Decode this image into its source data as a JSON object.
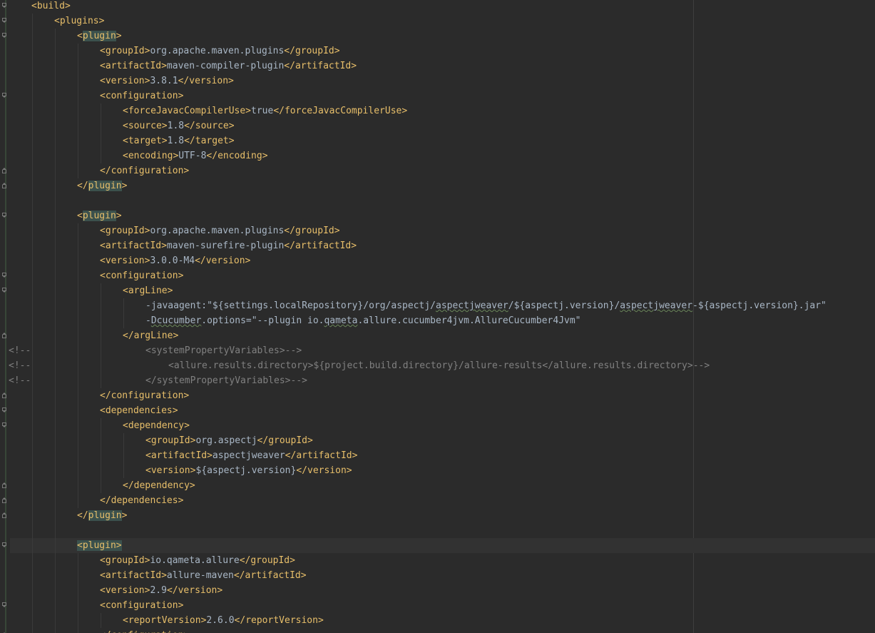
{
  "editor": {
    "lines": [
      {
        "fold": "open",
        "indent": 1,
        "tokens": [
          {
            "t": "<build>",
            "c": "tag"
          }
        ]
      },
      {
        "fold": "open",
        "indent": 2,
        "tokens": [
          {
            "t": "<plugins>",
            "c": "tag"
          }
        ]
      },
      {
        "fold": "open",
        "indent": 3,
        "tokens": [
          {
            "t": "<",
            "c": "tag"
          },
          {
            "t": "plugin",
            "c": "tag-hl"
          },
          {
            "t": ">",
            "c": "tag"
          }
        ]
      },
      {
        "fold": "",
        "indent": 4,
        "tokens": [
          {
            "t": "<groupId>",
            "c": "tag"
          },
          {
            "t": "org.apache.maven.plugins",
            "c": "text"
          },
          {
            "t": "</groupId>",
            "c": "tag"
          }
        ]
      },
      {
        "fold": "",
        "indent": 4,
        "tokens": [
          {
            "t": "<artifactId>",
            "c": "tag"
          },
          {
            "t": "maven-compiler-plugin",
            "c": "text"
          },
          {
            "t": "</artifactId>",
            "c": "tag"
          }
        ]
      },
      {
        "fold": "",
        "indent": 4,
        "tokens": [
          {
            "t": "<version>",
            "c": "tag"
          },
          {
            "t": "3.8.1",
            "c": "text"
          },
          {
            "t": "</version>",
            "c": "tag"
          }
        ]
      },
      {
        "fold": "open",
        "indent": 4,
        "tokens": [
          {
            "t": "<configuration>",
            "c": "tag"
          }
        ]
      },
      {
        "fold": "",
        "indent": 5,
        "tokens": [
          {
            "t": "<forceJavacCompilerUse>",
            "c": "tag"
          },
          {
            "t": "true",
            "c": "text"
          },
          {
            "t": "</forceJavacCompilerUse>",
            "c": "tag"
          }
        ]
      },
      {
        "fold": "",
        "indent": 5,
        "tokens": [
          {
            "t": "<source>",
            "c": "tag"
          },
          {
            "t": "1.8",
            "c": "text"
          },
          {
            "t": "</source>",
            "c": "tag"
          }
        ]
      },
      {
        "fold": "",
        "indent": 5,
        "tokens": [
          {
            "t": "<target>",
            "c": "tag"
          },
          {
            "t": "1.8",
            "c": "text"
          },
          {
            "t": "</target>",
            "c": "tag"
          }
        ]
      },
      {
        "fold": "",
        "indent": 5,
        "tokens": [
          {
            "t": "<encoding>",
            "c": "tag"
          },
          {
            "t": "UTF-8",
            "c": "text"
          },
          {
            "t": "</encoding>",
            "c": "tag"
          }
        ]
      },
      {
        "fold": "close",
        "indent": 4,
        "tokens": [
          {
            "t": "</configuration>",
            "c": "tag"
          }
        ]
      },
      {
        "fold": "close",
        "indent": 3,
        "tokens": [
          {
            "t": "</",
            "c": "tag"
          },
          {
            "t": "plugin",
            "c": "tag-hl"
          },
          {
            "t": ">",
            "c": "tag"
          }
        ]
      },
      {
        "fold": "",
        "indent": 0,
        "tokens": []
      },
      {
        "fold": "open",
        "indent": 3,
        "tokens": [
          {
            "t": "<",
            "c": "tag"
          },
          {
            "t": "plugin",
            "c": "tag-hl"
          },
          {
            "t": ">",
            "c": "tag"
          }
        ]
      },
      {
        "fold": "",
        "indent": 4,
        "tokens": [
          {
            "t": "<groupId>",
            "c": "tag"
          },
          {
            "t": "org.apache.maven.plugins",
            "c": "text"
          },
          {
            "t": "</groupId>",
            "c": "tag"
          }
        ]
      },
      {
        "fold": "",
        "indent": 4,
        "tokens": [
          {
            "t": "<artifactId>",
            "c": "tag"
          },
          {
            "t": "maven-surefire-plugin",
            "c": "text"
          },
          {
            "t": "</artifactId>",
            "c": "tag"
          }
        ]
      },
      {
        "fold": "",
        "indent": 4,
        "tokens": [
          {
            "t": "<version>",
            "c": "tag"
          },
          {
            "t": "3.0.0-M4",
            "c": "text"
          },
          {
            "t": "</version>",
            "c": "tag"
          }
        ]
      },
      {
        "fold": "open",
        "indent": 4,
        "tokens": [
          {
            "t": "<configuration>",
            "c": "tag"
          }
        ]
      },
      {
        "fold": "open",
        "indent": 5,
        "tokens": [
          {
            "t": "<argLine>",
            "c": "tag"
          }
        ]
      },
      {
        "fold": "",
        "indent": 6,
        "tokens": [
          {
            "t": "-javaagent:\"${settings.localRepository}/org/aspectj/",
            "c": "text"
          },
          {
            "t": "aspectjweaver",
            "c": "text warn"
          },
          {
            "t": "/${aspectj.version}/",
            "c": "text"
          },
          {
            "t": "aspectjweaver",
            "c": "text warn"
          },
          {
            "t": "-${aspectj.version}.jar\"",
            "c": "text"
          }
        ]
      },
      {
        "fold": "",
        "indent": 6,
        "tokens": [
          {
            "t": "-",
            "c": "text"
          },
          {
            "t": "Dcucumber",
            "c": "text warn"
          },
          {
            "t": ".options=\"--plugin io.",
            "c": "text"
          },
          {
            "t": "qameta",
            "c": "text warn"
          },
          {
            "t": ".allure.cucumber4jvm.AllureCucumber4Jvm\"",
            "c": "text"
          }
        ]
      },
      {
        "fold": "close",
        "indent": 5,
        "tokens": [
          {
            "t": "</argLine>",
            "c": "tag"
          }
        ]
      },
      {
        "fold": "",
        "indent": 0,
        "prefix": "<!--",
        "tokens": [
          {
            "t": "<systemPropertyVariables>-->",
            "c": "comment"
          }
        ],
        "commentIndent": 6
      },
      {
        "fold": "",
        "indent": 0,
        "prefix": "<!--",
        "tokens": [
          {
            "t": "<allure.results.directory>${project.build.directory}/allure-results</allure.results.directory>-->",
            "c": "comment"
          }
        ],
        "commentIndent": 7
      },
      {
        "fold": "",
        "indent": 0,
        "prefix": "<!--",
        "tokens": [
          {
            "t": "</systemPropertyVariables>-->",
            "c": "comment"
          }
        ],
        "commentIndent": 6
      },
      {
        "fold": "close",
        "indent": 4,
        "tokens": [
          {
            "t": "</configuration>",
            "c": "tag"
          }
        ]
      },
      {
        "fold": "open",
        "indent": 4,
        "tokens": [
          {
            "t": "<dependencies>",
            "c": "tag"
          }
        ]
      },
      {
        "fold": "open",
        "indent": 5,
        "tokens": [
          {
            "t": "<dependency>",
            "c": "tag"
          }
        ]
      },
      {
        "fold": "",
        "indent": 6,
        "tokens": [
          {
            "t": "<groupId>",
            "c": "tag"
          },
          {
            "t": "org.aspectj",
            "c": "text"
          },
          {
            "t": "</groupId>",
            "c": "tag"
          }
        ]
      },
      {
        "fold": "",
        "indent": 6,
        "tokens": [
          {
            "t": "<artifactId>",
            "c": "tag"
          },
          {
            "t": "aspectjweaver",
            "c": "text"
          },
          {
            "t": "</artifactId>",
            "c": "tag"
          }
        ]
      },
      {
        "fold": "",
        "indent": 6,
        "tokens": [
          {
            "t": "<version>",
            "c": "tag"
          },
          {
            "t": "${aspectj.version}",
            "c": "text"
          },
          {
            "t": "</version>",
            "c": "tag"
          }
        ]
      },
      {
        "fold": "close",
        "indent": 5,
        "tokens": [
          {
            "t": "</dependency>",
            "c": "tag"
          }
        ]
      },
      {
        "fold": "close",
        "indent": 4,
        "tokens": [
          {
            "t": "</dependencies>",
            "c": "tag"
          }
        ]
      },
      {
        "fold": "close",
        "indent": 3,
        "tokens": [
          {
            "t": "</",
            "c": "tag"
          },
          {
            "t": "plugin",
            "c": "tag-hl"
          },
          {
            "t": ">",
            "c": "tag"
          }
        ]
      },
      {
        "fold": "",
        "indent": 0,
        "tokens": []
      },
      {
        "fold": "open",
        "indent": 3,
        "caret": true,
        "tokens": [
          {
            "t": "<plugin>",
            "c": "tag-hl"
          }
        ]
      },
      {
        "fold": "",
        "indent": 4,
        "tokens": [
          {
            "t": "<groupId>",
            "c": "tag"
          },
          {
            "t": "io.qameta.allure",
            "c": "text"
          },
          {
            "t": "</groupId>",
            "c": "tag"
          }
        ]
      },
      {
        "fold": "",
        "indent": 4,
        "tokens": [
          {
            "t": "<artifactId>",
            "c": "tag"
          },
          {
            "t": "allure-maven",
            "c": "text"
          },
          {
            "t": "</artifactId>",
            "c": "tag"
          }
        ]
      },
      {
        "fold": "",
        "indent": 4,
        "tokens": [
          {
            "t": "<version>",
            "c": "tag"
          },
          {
            "t": "2.9",
            "c": "text"
          },
          {
            "t": "</version>",
            "c": "tag"
          }
        ]
      },
      {
        "fold": "open",
        "indent": 4,
        "tokens": [
          {
            "t": "<configuration>",
            "c": "tag"
          }
        ]
      },
      {
        "fold": "",
        "indent": 5,
        "tokens": [
          {
            "t": "<reportVersion>",
            "c": "tag"
          },
          {
            "t": "2.6.0",
            "c": "text"
          },
          {
            "t": "</reportVersion>",
            "c": "tag"
          }
        ]
      },
      {
        "fold": "close",
        "indent": 4,
        "tokens": [
          {
            "t": "</configuration>",
            "c": "tag"
          }
        ]
      }
    ]
  }
}
